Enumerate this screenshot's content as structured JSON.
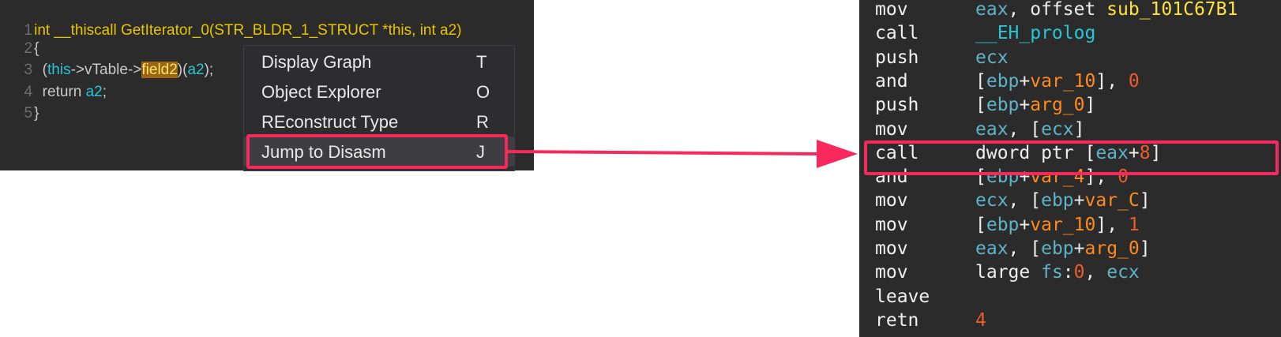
{
  "decompiler": {
    "lines": [
      {
        "num": "1",
        "parts": [
          {
            "text": "int __thiscall GetIterator_0(STR_BLDR_1_STRUCT *this, int a2)",
            "cls": "t-y"
          }
        ]
      },
      {
        "num": "2",
        "parts": [
          {
            "text": "{",
            "cls": "t-w"
          }
        ]
      },
      {
        "num": "3",
        "parts": [
          {
            "text": "  (",
            "cls": "t-w"
          },
          {
            "text": "this",
            "cls": "t-c"
          },
          {
            "text": "->vTable->",
            "cls": "t-w"
          },
          {
            "text": "field2",
            "cls": "t-field"
          },
          {
            "text": ")(",
            "cls": "t-w"
          },
          {
            "text": "a2",
            "cls": "t-c"
          },
          {
            "text": ");",
            "cls": "t-w"
          }
        ]
      },
      {
        "num": "4",
        "parts": [
          {
            "text": "  return ",
            "cls": "t-w"
          },
          {
            "text": "a2",
            "cls": "t-c"
          },
          {
            "text": ";",
            "cls": "t-w"
          }
        ]
      },
      {
        "num": "5",
        "parts": [
          {
            "text": "}",
            "cls": "t-w"
          }
        ]
      }
    ]
  },
  "context_menu": {
    "items": [
      {
        "label": "Display Graph",
        "key": "T"
      },
      {
        "label": "Object Explorer",
        "key": "O"
      },
      {
        "label": "REconstruct Type",
        "key": "R"
      },
      {
        "label": "Jump to Disasm",
        "key": "J"
      }
    ]
  },
  "disassembly": {
    "lines": [
      {
        "mnemonic": "mov",
        "ops": [
          {
            "t": "eax",
            "c": "o-r"
          },
          {
            "t": ", offset ",
            "c": "o-w"
          },
          {
            "t": "sub_101C67B1",
            "c": "o-y"
          }
        ]
      },
      {
        "mnemonic": "call",
        "ops": [
          {
            "t": "__EH_prolog",
            "c": "o-c"
          }
        ]
      },
      {
        "mnemonic": "push",
        "ops": [
          {
            "t": "ecx",
            "c": "o-r"
          }
        ]
      },
      {
        "mnemonic": "and",
        "ops": [
          {
            "t": "[",
            "c": "o-w"
          },
          {
            "t": "ebp",
            "c": "o-r"
          },
          {
            "t": "+",
            "c": "o-w"
          },
          {
            "t": "var_10",
            "c": "o-o"
          },
          {
            "t": "], ",
            "c": "o-w"
          },
          {
            "t": "0",
            "c": "o-n"
          }
        ]
      },
      {
        "mnemonic": "push",
        "ops": [
          {
            "t": "[",
            "c": "o-w"
          },
          {
            "t": "ebp",
            "c": "o-r"
          },
          {
            "t": "+",
            "c": "o-w"
          },
          {
            "t": "arg_0",
            "c": "o-o"
          },
          {
            "t": "]",
            "c": "o-w"
          }
        ]
      },
      {
        "mnemonic": "mov",
        "ops": [
          {
            "t": "eax",
            "c": "o-r"
          },
          {
            "t": ", [",
            "c": "o-w"
          },
          {
            "t": "ecx",
            "c": "o-r"
          },
          {
            "t": "]",
            "c": "o-w"
          }
        ]
      },
      {
        "mnemonic": "call",
        "ops": [
          {
            "t": "dword ptr [",
            "c": "o-w"
          },
          {
            "t": "eax",
            "c": "o-r"
          },
          {
            "t": "+",
            "c": "o-w"
          },
          {
            "t": "8",
            "c": "o-n"
          },
          {
            "t": "]",
            "c": "o-w"
          }
        ]
      },
      {
        "mnemonic": "and",
        "ops": [
          {
            "t": "[",
            "c": "o-w"
          },
          {
            "t": "ebp",
            "c": "o-r"
          },
          {
            "t": "+",
            "c": "o-w"
          },
          {
            "t": "var_4",
            "c": "o-o"
          },
          {
            "t": "], ",
            "c": "o-w"
          },
          {
            "t": "0",
            "c": "o-n"
          }
        ]
      },
      {
        "mnemonic": "mov",
        "ops": [
          {
            "t": "ecx",
            "c": "o-r"
          },
          {
            "t": ", [",
            "c": "o-w"
          },
          {
            "t": "ebp",
            "c": "o-r"
          },
          {
            "t": "+",
            "c": "o-w"
          },
          {
            "t": "var_C",
            "c": "o-o"
          },
          {
            "t": "]",
            "c": "o-w"
          }
        ]
      },
      {
        "mnemonic": "mov",
        "ops": [
          {
            "t": "[",
            "c": "o-w"
          },
          {
            "t": "ebp",
            "c": "o-r"
          },
          {
            "t": "+",
            "c": "o-w"
          },
          {
            "t": "var_10",
            "c": "o-o"
          },
          {
            "t": "], ",
            "c": "o-w"
          },
          {
            "t": "1",
            "c": "o-n"
          }
        ]
      },
      {
        "mnemonic": "mov",
        "ops": [
          {
            "t": "eax",
            "c": "o-r"
          },
          {
            "t": ", [",
            "c": "o-w"
          },
          {
            "t": "ebp",
            "c": "o-r"
          },
          {
            "t": "+",
            "c": "o-w"
          },
          {
            "t": "arg_0",
            "c": "o-o"
          },
          {
            "t": "]",
            "c": "o-w"
          }
        ]
      },
      {
        "mnemonic": "mov",
        "ops": [
          {
            "t": "large ",
            "c": "o-w"
          },
          {
            "t": "fs",
            "c": "o-r"
          },
          {
            "t": ":",
            "c": "o-w"
          },
          {
            "t": "0",
            "c": "o-n"
          },
          {
            "t": ", ",
            "c": "o-w"
          },
          {
            "t": "ecx",
            "c": "o-r"
          }
        ]
      },
      {
        "mnemonic": "leave",
        "ops": []
      },
      {
        "mnemonic": "retn",
        "ops": [
          {
            "t": "4",
            "c": "o-n"
          }
        ]
      }
    ]
  },
  "colors": {
    "highlight_box": "#f7285c",
    "pane_background": "#2b2b2b",
    "menu_background": "#2d2d30"
  }
}
